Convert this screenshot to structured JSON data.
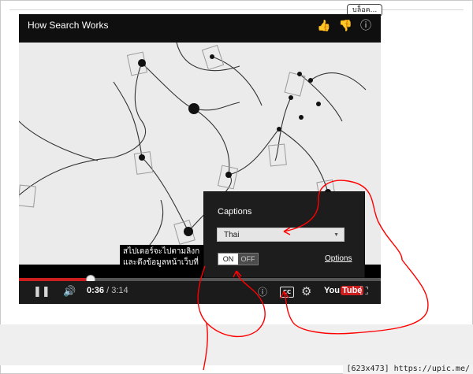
{
  "badge": {
    "text": "บล็อค..."
  },
  "video": {
    "title": "How Search Works"
  },
  "caption": {
    "line1": "สไปเดอร์จะไปตามลิงก",
    "line2": "และดึงข้อมูลหน้าเว็บที่"
  },
  "controls": {
    "current_time": "0:36",
    "separator": " / ",
    "duration": "3:14",
    "progress_fraction": 0.197,
    "cc_label": "CC"
  },
  "youtube": {
    "you": "You",
    "tube": "Tube"
  },
  "captions_panel": {
    "title": "Captions",
    "language": "Thai",
    "on_label": "ON",
    "off_label": "OFF",
    "options_label": "Options"
  },
  "watermark": {
    "text": "[623x473] https://upic.me/"
  },
  "colors": {
    "accent_red": "#cc1e1e",
    "annotation_red": "#ff0000",
    "panel_bg": "#1d1d1d"
  }
}
